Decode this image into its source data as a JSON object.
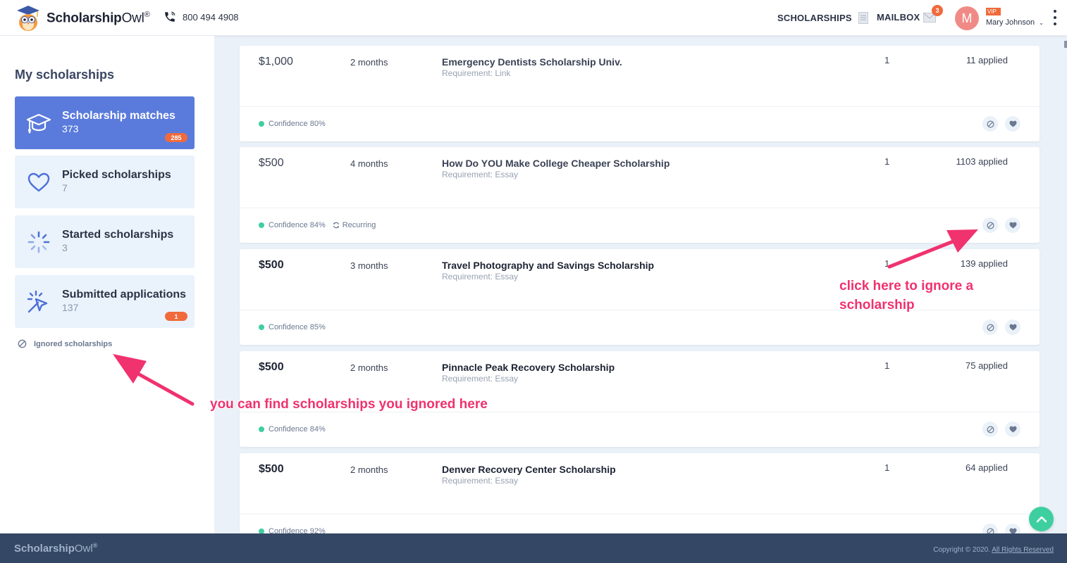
{
  "header": {
    "logo_bold": "Scholarship",
    "logo_light": "Owl",
    "logo_reg": "®",
    "phone": "800 494 4908",
    "nav_scholarships": "SCHOLARSHIPS",
    "nav_mailbox": "MAILBOX",
    "mail_badge": "3",
    "avatar_letter": "M",
    "vip": "VIP",
    "user_name": "Mary Johnson"
  },
  "sidebar": {
    "title": "My scholarships",
    "items": [
      {
        "label": "Scholarship matches",
        "count": "373",
        "badge": "285",
        "icon": "graduation-cap-icon"
      },
      {
        "label": "Picked scholarships",
        "count": "7",
        "badge": "",
        "icon": "heart-icon"
      },
      {
        "label": "Started scholarships",
        "count": "3",
        "badge": "",
        "icon": "spinner-icon"
      },
      {
        "label": "Submitted applications",
        "count": "137",
        "badge": "1",
        "icon": "cursor-click-icon"
      }
    ],
    "ignored_link": "Ignored scholarships"
  },
  "scholarships": [
    {
      "amount": "$1,000",
      "deadline": "2 months",
      "title": "Emergency Dentists Scholarship Univ.",
      "requirement": "Requirement: Link",
      "num": "1",
      "applied": "11 applied",
      "confidence": "Confidence 80%",
      "recurring": ""
    },
    {
      "amount": "$500",
      "deadline": "4 months",
      "title": "How Do YOU Make College Cheaper Scholarship",
      "requirement": "Requirement: Essay",
      "num": "1",
      "applied": "1103 applied",
      "confidence": "Confidence 84%",
      "recurring": "Recurring"
    },
    {
      "amount": "$500",
      "deadline": "3 months",
      "title": "Travel Photography and Savings Scholarship",
      "requirement": "Requirement: Essay",
      "num": "1",
      "applied": "139 applied",
      "confidence": "Confidence 85%",
      "recurring": ""
    },
    {
      "amount": "$500",
      "deadline": "2 months",
      "title": "Pinnacle Peak Recovery Scholarship",
      "requirement": "Requirement: Essay",
      "num": "1",
      "applied": "75 applied",
      "confidence": "Confidence 84%",
      "recurring": ""
    },
    {
      "amount": "$500",
      "deadline": "2 months",
      "title": "Denver Recovery Center Scholarship",
      "requirement": "Requirement: Essay",
      "num": "1",
      "applied": "64 applied",
      "confidence": "Confidence 92%",
      "recurring": ""
    }
  ],
  "annotations": {
    "ignore_hint_line1": "click here to ignore a",
    "ignore_hint_line2": "scholarship",
    "find_hint": "you can find scholarships you ignored here"
  },
  "footer": {
    "logo_bold": "Scholarship",
    "logo_light": "Owl",
    "logo_reg": "®",
    "copyright": "Copyright © 2020.",
    "rights": "All Rights Reserved"
  },
  "colors": {
    "accent_blue": "#5a7bdc",
    "badge_orange": "#f06a3b",
    "confidence_green": "#3ecfa0",
    "annotation_pink": "#f0326f",
    "footer_navy": "#344764"
  }
}
